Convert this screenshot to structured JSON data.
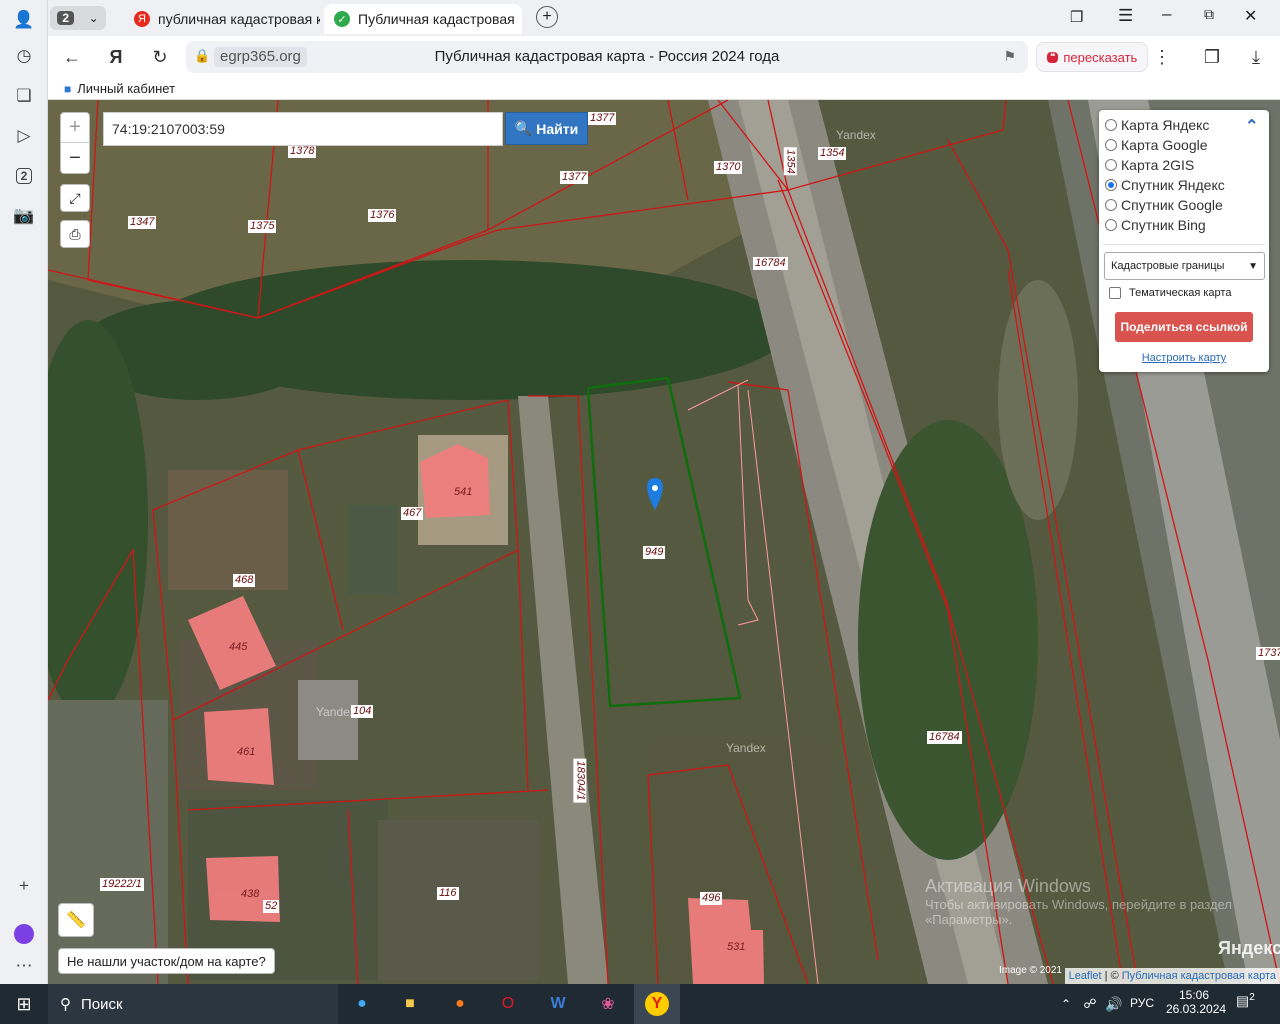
{
  "browser": {
    "tab_count": "2",
    "tabs": [
      {
        "label": "публичная кадастровая к",
        "icon": "yandex-favicon-icon"
      },
      {
        "label": "Публичная кадастровая",
        "icon": "check-favicon-icon"
      }
    ],
    "url_host": "egrp365.org",
    "page_title": "Публичная кадастровая карта - Россия 2024 года",
    "retell_label": "пересказать",
    "bookmark_label": "Личный кабинет",
    "sidebar_badge": "2"
  },
  "map": {
    "search_value": "74:19:2107003:59",
    "search_button": "Найти",
    "zoom_in": "+",
    "zoom_out": "−",
    "layers": [
      {
        "label": "Карта Яндекс",
        "selected": false
      },
      {
        "label": "Карта Google",
        "selected": false
      },
      {
        "label": "Карта 2GIS",
        "selected": false
      },
      {
        "label": "Спутник Яндекс",
        "selected": true
      },
      {
        "label": "Спутник Google",
        "selected": false
      },
      {
        "label": "Спутник Bing",
        "selected": false
      }
    ],
    "boundary_select": "Кадастровые границы",
    "thematic_label": "Тематическая карта",
    "share_button": "Поделиться ссылкой",
    "configure_link": "Настроить карту",
    "not_found": "Не нашли участок/дом на карте?",
    "attribution_leaflet": "Leaflet",
    "attribution_sep": " | © ",
    "attribution_pkk": "Публичная кадастровая карта",
    "image_credit": "Image © 2021",
    "yandex_logo": "Яндекс",
    "watermark": "Yandex",
    "parcel_labels": [
      "1378",
      "1377",
      "1370",
      "1354",
      "1354",
      "1347",
      "1375",
      "1376",
      "1377",
      "16784",
      "541",
      "467",
      "949",
      "468",
      "445",
      "104",
      "461",
      "18304/1",
      "16784",
      "19222/1",
      "438",
      "52",
      "116",
      "496",
      "531",
      "1737"
    ],
    "activate_title": "Активация Windows",
    "activate_sub": "Чтобы активировать Windows, перейдите в раздел «Параметры»."
  },
  "taskbar": {
    "search_label": "Поиск",
    "lang": "РУС",
    "time": "15:06",
    "date": "26.03.2024",
    "notifications": "2"
  }
}
